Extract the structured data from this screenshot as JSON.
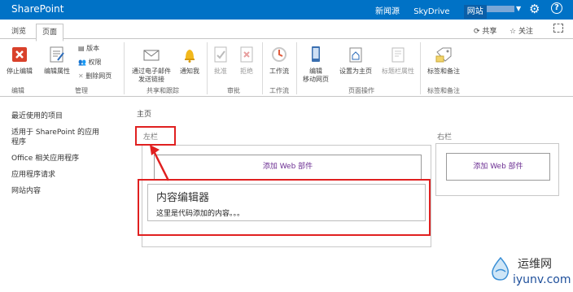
{
  "suitebar": {
    "brand": "SharePoint",
    "links": [
      "新闻源",
      "SkyDrive",
      "网站"
    ],
    "settings_icon": "gear-icon",
    "help_label": "?"
  },
  "tabs": {
    "browse": "浏览",
    "page": "页面",
    "share": "共享",
    "follow": "关注"
  },
  "ribbon": {
    "stop_editing": "停止编辑",
    "edit_properties": "编辑属性",
    "version": "版本",
    "permissions": "权限",
    "delete_page": "删除网页",
    "email_link_line1": "通过电子邮件",
    "email_link_line2": "发送链接",
    "alert_me": "通知我",
    "approve": "批准",
    "reject": "拒绝",
    "workflow": "工作流",
    "edit_mobile_line1": "编辑",
    "edit_mobile_line2": "移动网页",
    "set_home": "设置为主页",
    "title_bar_props": "标题栏属性",
    "tags_notes": "标签和备注",
    "groups": {
      "edit": "编辑",
      "manage": "管理",
      "share_track": "共享和跟踪",
      "approval": "审批",
      "workflow": "工作流",
      "page_actions": "页面操作",
      "tags_notes": "标签和备注"
    }
  },
  "leftnav": {
    "items": [
      "最近使用的项目",
      "适用于 SharePoint 的应用",
      "程序",
      "Office 相关应用程序",
      "应用程序请求",
      "网站内容"
    ]
  },
  "main": {
    "breadcrumb": "主页",
    "left_zone_title": "左栏",
    "right_zone_title": "右栏",
    "add_web_part": "添加 Web 部件",
    "content_editor_title": "内容编辑器",
    "content_editor_body": "这里是代码添加的内容。。。"
  },
  "watermark": {
    "line1": "运维网",
    "line2": "iyunv.com"
  },
  "colors": {
    "suitebar": "#0072c6",
    "accent_purple": "#6a2c91",
    "annotation_red": "#e02020"
  }
}
